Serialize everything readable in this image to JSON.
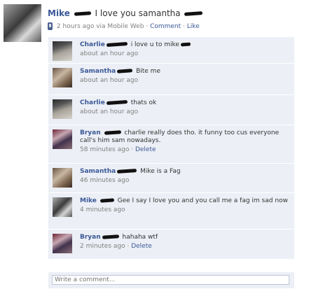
{
  "post": {
    "author": "Mike",
    "text": "I love you samantha",
    "time": "2 hours ago via Mobile Web",
    "sep1": "·",
    "comment_link": "Comment",
    "sep2": "·",
    "like_link": "Like"
  },
  "comments": [
    {
      "name": "Charlie",
      "text": "i love u to mike",
      "time": "about an hour ago",
      "delete": ""
    },
    {
      "name": "Samantha",
      "text": "Bite me",
      "time": "about an hour ago",
      "delete": ""
    },
    {
      "name": "Charlie",
      "text": "thats ok",
      "time": "about an hour ago",
      "delete": ""
    },
    {
      "name": "Bryan",
      "text": "charlie really does tho. it funny too cus everyone call's him sam nowadays.",
      "time": "58 minutes ago",
      "delete": "Delete"
    },
    {
      "name": "Samantha",
      "text": "Mike is a Fag",
      "time": "46 minutes ago",
      "delete": ""
    },
    {
      "name": "Mike",
      "text": "Gee I say I love you and you call me a fag im sad now",
      "time": "4 minutes ago",
      "delete": ""
    },
    {
      "name": "Bryan",
      "text": "hahaha wtf",
      "time": "2 minutes ago",
      "delete": "Delete"
    }
  ],
  "write_comment": {
    "placeholder": "Write a comment..."
  },
  "icons": {
    "mobile": "mobile-phone-icon"
  }
}
